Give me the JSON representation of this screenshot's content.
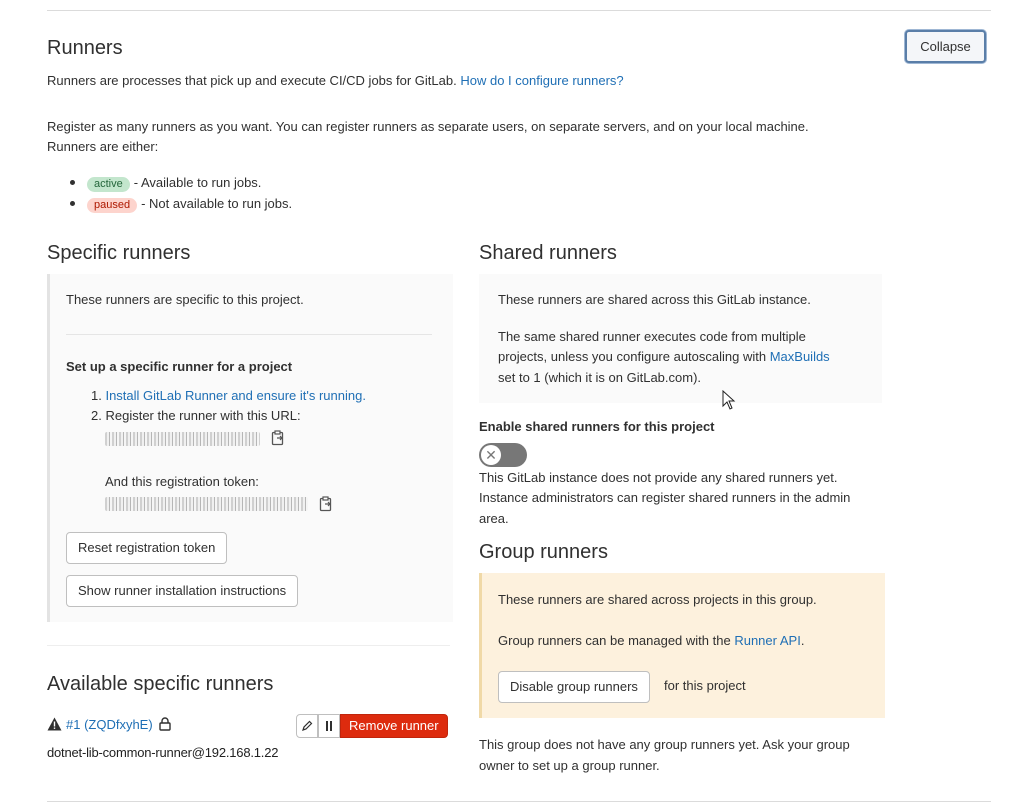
{
  "header": {
    "title": "Runners",
    "collapse_label": "Collapse",
    "intro_text": "Runners are processes that pick up and execute CI/CD jobs for GitLab.",
    "intro_link": "How do I configure runners?",
    "register_line1": "Register as many runners as you want. You can register runners as separate users, on separate servers, and on your local machine.",
    "register_line2": "Runners are either:",
    "states": [
      {
        "badge": "active",
        "text": "- Available to run jobs."
      },
      {
        "badge": "paused",
        "text": "- Not available to run jobs."
      }
    ]
  },
  "specific": {
    "title": "Specific runners",
    "desc": "These runners are specific to this project.",
    "setup_title": "Set up a specific runner for a project",
    "step1_link": "Install GitLab Runner and ensure it's running.",
    "step2_text": "Register the runner with this URL:",
    "token_text": "And this registration token:",
    "reset_button": "Reset registration token",
    "show_button": "Show runner installation instructions"
  },
  "available": {
    "title": "Available specific runners",
    "runner_link": "#1 (ZQDfxyhE)",
    "remove_button": "Remove runner",
    "runner_description": "dotnet-lib-common-runner@192.168.1.22"
  },
  "shared": {
    "title": "Shared runners",
    "desc1": "These runners are shared across this GitLab instance.",
    "desc2_line1": "The same shared runner executes code from multiple",
    "desc2_line2_pre": "projects, unless you configure autoscaling with",
    "desc2_link": "MaxBuilds",
    "desc2_line3": "set to 1 (which it is on GitLab.com).",
    "enable_label": "Enable shared runners for this project",
    "none_line1": "This GitLab instance does not provide any shared runners yet.",
    "none_line2": "Instance administrators can register shared runners in the admin",
    "none_line3": "area."
  },
  "group": {
    "title": "Group runners",
    "desc1": "These runners are shared across projects in this group.",
    "desc2_pre": "Group runners can be managed with the",
    "desc2_link": "Runner API",
    "desc2_post": ".",
    "disable_button": "Disable group runners",
    "for_project": "for this project",
    "none_line1": "This group does not have any group runners yet. Ask your group",
    "none_line2": "owner to set up a group runner."
  },
  "colors": {
    "link": "#1f6fb5",
    "active_bg": "#c3e6cd",
    "active_fg": "#24663b",
    "paused_bg": "#fdd4cd",
    "paused_fg": "#ae1800",
    "danger": "#dd2b0e",
    "warn_bg": "#fdf1dd"
  }
}
